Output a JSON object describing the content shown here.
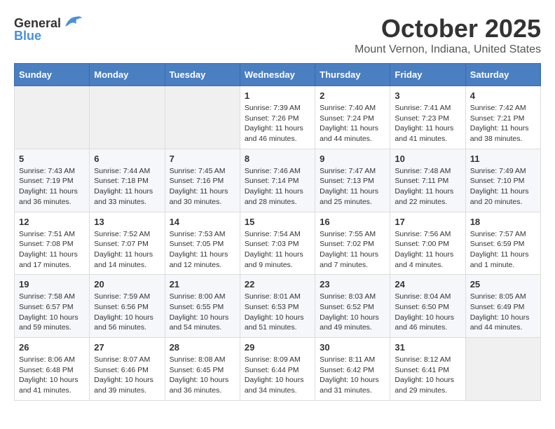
{
  "header": {
    "logo_general": "General",
    "logo_blue": "Blue",
    "month_title": "October 2025",
    "location": "Mount Vernon, Indiana, United States"
  },
  "days_of_week": [
    "Sunday",
    "Monday",
    "Tuesday",
    "Wednesday",
    "Thursday",
    "Friday",
    "Saturday"
  ],
  "weeks": [
    [
      {
        "day": "",
        "info": ""
      },
      {
        "day": "",
        "info": ""
      },
      {
        "day": "",
        "info": ""
      },
      {
        "day": "1",
        "info": "Sunrise: 7:39 AM\nSunset: 7:26 PM\nDaylight: 11 hours and 46 minutes."
      },
      {
        "day": "2",
        "info": "Sunrise: 7:40 AM\nSunset: 7:24 PM\nDaylight: 11 hours and 44 minutes."
      },
      {
        "day": "3",
        "info": "Sunrise: 7:41 AM\nSunset: 7:23 PM\nDaylight: 11 hours and 41 minutes."
      },
      {
        "day": "4",
        "info": "Sunrise: 7:42 AM\nSunset: 7:21 PM\nDaylight: 11 hours and 38 minutes."
      }
    ],
    [
      {
        "day": "5",
        "info": "Sunrise: 7:43 AM\nSunset: 7:19 PM\nDaylight: 11 hours and 36 minutes."
      },
      {
        "day": "6",
        "info": "Sunrise: 7:44 AM\nSunset: 7:18 PM\nDaylight: 11 hours and 33 minutes."
      },
      {
        "day": "7",
        "info": "Sunrise: 7:45 AM\nSunset: 7:16 PM\nDaylight: 11 hours and 30 minutes."
      },
      {
        "day": "8",
        "info": "Sunrise: 7:46 AM\nSunset: 7:14 PM\nDaylight: 11 hours and 28 minutes."
      },
      {
        "day": "9",
        "info": "Sunrise: 7:47 AM\nSunset: 7:13 PM\nDaylight: 11 hours and 25 minutes."
      },
      {
        "day": "10",
        "info": "Sunrise: 7:48 AM\nSunset: 7:11 PM\nDaylight: 11 hours and 22 minutes."
      },
      {
        "day": "11",
        "info": "Sunrise: 7:49 AM\nSunset: 7:10 PM\nDaylight: 11 hours and 20 minutes."
      }
    ],
    [
      {
        "day": "12",
        "info": "Sunrise: 7:51 AM\nSunset: 7:08 PM\nDaylight: 11 hours and 17 minutes."
      },
      {
        "day": "13",
        "info": "Sunrise: 7:52 AM\nSunset: 7:07 PM\nDaylight: 11 hours and 14 minutes."
      },
      {
        "day": "14",
        "info": "Sunrise: 7:53 AM\nSunset: 7:05 PM\nDaylight: 11 hours and 12 minutes."
      },
      {
        "day": "15",
        "info": "Sunrise: 7:54 AM\nSunset: 7:03 PM\nDaylight: 11 hours and 9 minutes."
      },
      {
        "day": "16",
        "info": "Sunrise: 7:55 AM\nSunset: 7:02 PM\nDaylight: 11 hours and 7 minutes."
      },
      {
        "day": "17",
        "info": "Sunrise: 7:56 AM\nSunset: 7:00 PM\nDaylight: 11 hours and 4 minutes."
      },
      {
        "day": "18",
        "info": "Sunrise: 7:57 AM\nSunset: 6:59 PM\nDaylight: 11 hours and 1 minute."
      }
    ],
    [
      {
        "day": "19",
        "info": "Sunrise: 7:58 AM\nSunset: 6:57 PM\nDaylight: 10 hours and 59 minutes."
      },
      {
        "day": "20",
        "info": "Sunrise: 7:59 AM\nSunset: 6:56 PM\nDaylight: 10 hours and 56 minutes."
      },
      {
        "day": "21",
        "info": "Sunrise: 8:00 AM\nSunset: 6:55 PM\nDaylight: 10 hours and 54 minutes."
      },
      {
        "day": "22",
        "info": "Sunrise: 8:01 AM\nSunset: 6:53 PM\nDaylight: 10 hours and 51 minutes."
      },
      {
        "day": "23",
        "info": "Sunrise: 8:03 AM\nSunset: 6:52 PM\nDaylight: 10 hours and 49 minutes."
      },
      {
        "day": "24",
        "info": "Sunrise: 8:04 AM\nSunset: 6:50 PM\nDaylight: 10 hours and 46 minutes."
      },
      {
        "day": "25",
        "info": "Sunrise: 8:05 AM\nSunset: 6:49 PM\nDaylight: 10 hours and 44 minutes."
      }
    ],
    [
      {
        "day": "26",
        "info": "Sunrise: 8:06 AM\nSunset: 6:48 PM\nDaylight: 10 hours and 41 minutes."
      },
      {
        "day": "27",
        "info": "Sunrise: 8:07 AM\nSunset: 6:46 PM\nDaylight: 10 hours and 39 minutes."
      },
      {
        "day": "28",
        "info": "Sunrise: 8:08 AM\nSunset: 6:45 PM\nDaylight: 10 hours and 36 minutes."
      },
      {
        "day": "29",
        "info": "Sunrise: 8:09 AM\nSunset: 6:44 PM\nDaylight: 10 hours and 34 minutes."
      },
      {
        "day": "30",
        "info": "Sunrise: 8:11 AM\nSunset: 6:42 PM\nDaylight: 10 hours and 31 minutes."
      },
      {
        "day": "31",
        "info": "Sunrise: 8:12 AM\nSunset: 6:41 PM\nDaylight: 10 hours and 29 minutes."
      },
      {
        "day": "",
        "info": ""
      }
    ]
  ]
}
